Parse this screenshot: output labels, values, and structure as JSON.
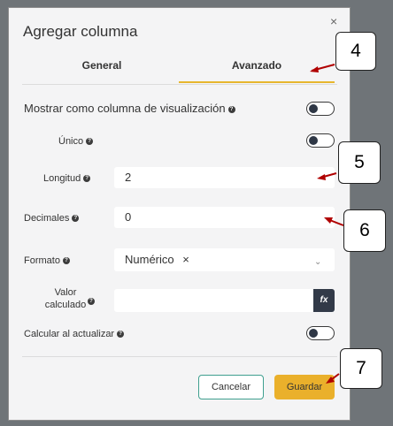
{
  "dialog": {
    "title": "Agregar columna",
    "close_symbol": "×"
  },
  "tabs": [
    {
      "label": "General",
      "active": false
    },
    {
      "label": "Avanzado",
      "active": true
    }
  ],
  "fields": {
    "mostrar": {
      "label": "Mostrar como columna de visualización",
      "on": false
    },
    "unico": {
      "label": "Único",
      "on": false
    },
    "longitud": {
      "label": "Longitud",
      "value": "2"
    },
    "decimales": {
      "label": "Decimales",
      "value": "0"
    },
    "formato": {
      "label": "Formato",
      "value": "Numérico",
      "remove": "×",
      "caret": "⌄"
    },
    "valor_calculado": {
      "label_line1": "Valor",
      "label_line2": "calculado",
      "value": "",
      "fx": "fx"
    },
    "calcular": {
      "label": "Calcular al actualizar",
      "on": false
    }
  },
  "help_icon": "?",
  "buttons": {
    "cancel": "Cancelar",
    "save": "Guardar"
  },
  "callouts": [
    "4",
    "5",
    "6",
    "7"
  ],
  "colors": {
    "accent": "#eab02b",
    "cancel_border": "#3f9f8f",
    "callout_arrow": "#b00000"
  }
}
